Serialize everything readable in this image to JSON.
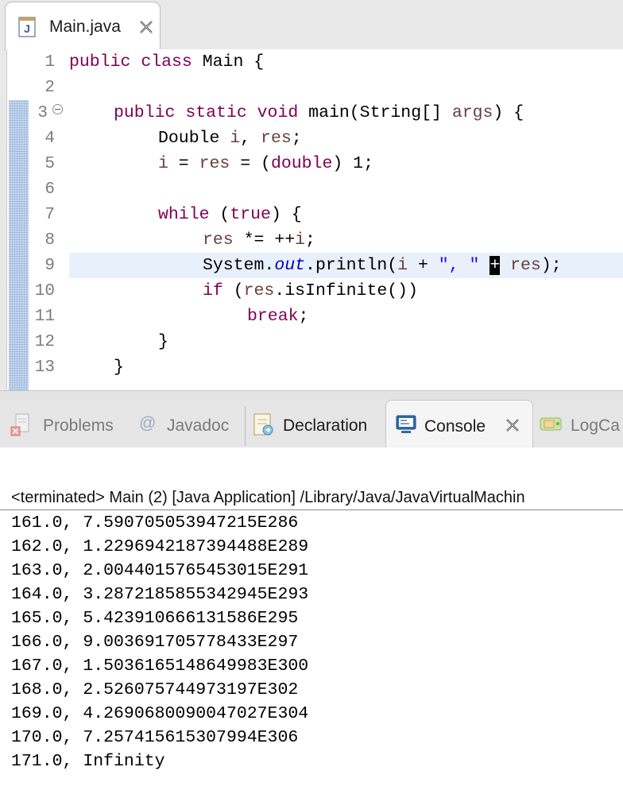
{
  "editor": {
    "tab_title": "Main.java",
    "line_numbers": [
      "1",
      "2",
      "3",
      "4",
      "5",
      "6",
      "7",
      "8",
      "9",
      "10",
      "11",
      "12",
      "13"
    ],
    "code": {
      "l1": {
        "kw1": "public",
        "kw2": "class",
        "rest": " Main {"
      },
      "l3": {
        "kw1": "public",
        "kw2": "static",
        "kw3": "void",
        "mid": " main(String[] ",
        "var": "args",
        "rest": ") {"
      },
      "l4": {
        "type": "Double ",
        "v1": "i",
        "sep": ", ",
        "v2": "res",
        "rest": ";"
      },
      "l5": {
        "v1": "i",
        "eq1": " = ",
        "v2": "res",
        "eq2": " = (",
        "kw": "double",
        "rest": ") 1;"
      },
      "l7": {
        "kw1": "while",
        "p": " (",
        "kw2": "true",
        "rest": ") {"
      },
      "l8": {
        "v": "res",
        "rest": " *= ++",
        "v2": "i",
        "end": ";"
      },
      "l9": {
        "a": "System.",
        "field": "out",
        "b": ".println(",
        "v1": "i",
        "c": " + ",
        "str": "\", \"",
        "d": " ",
        "plus": "+",
        "e": " ",
        "v2": "res",
        "f": ");"
      },
      "l10": {
        "kw": "if",
        "p": " (",
        "v": "res",
        "rest": ".isInfinite())"
      },
      "l11": {
        "kw": "break",
        "rest": ";"
      },
      "l12": {
        "text": "}"
      },
      "l13": {
        "text": "}"
      }
    }
  },
  "views": {
    "tabs": [
      "Problems",
      "Javadoc",
      "Declaration",
      "Console",
      "LogCa"
    ],
    "active": "Console"
  },
  "console": {
    "header": "<terminated> Main (2) [Java Application] /Library/Java/JavaVirtualMachin",
    "lines": [
      "161.0, 7.590705053947215E286",
      "162.0, 1.2296942187394488E289",
      "163.0, 2.0044015765453015E291",
      "164.0, 3.2872185855342945E293",
      "165.0, 5.423910666131586E295",
      "166.0, 9.003691705778433E297",
      "167.0, 1.5036165148649983E300",
      "168.0, 2.526075744973197E302",
      "169.0, 4.2690680090047027E304",
      "170.0, 7.257415615307994E306",
      "171.0, Infinity"
    ]
  }
}
